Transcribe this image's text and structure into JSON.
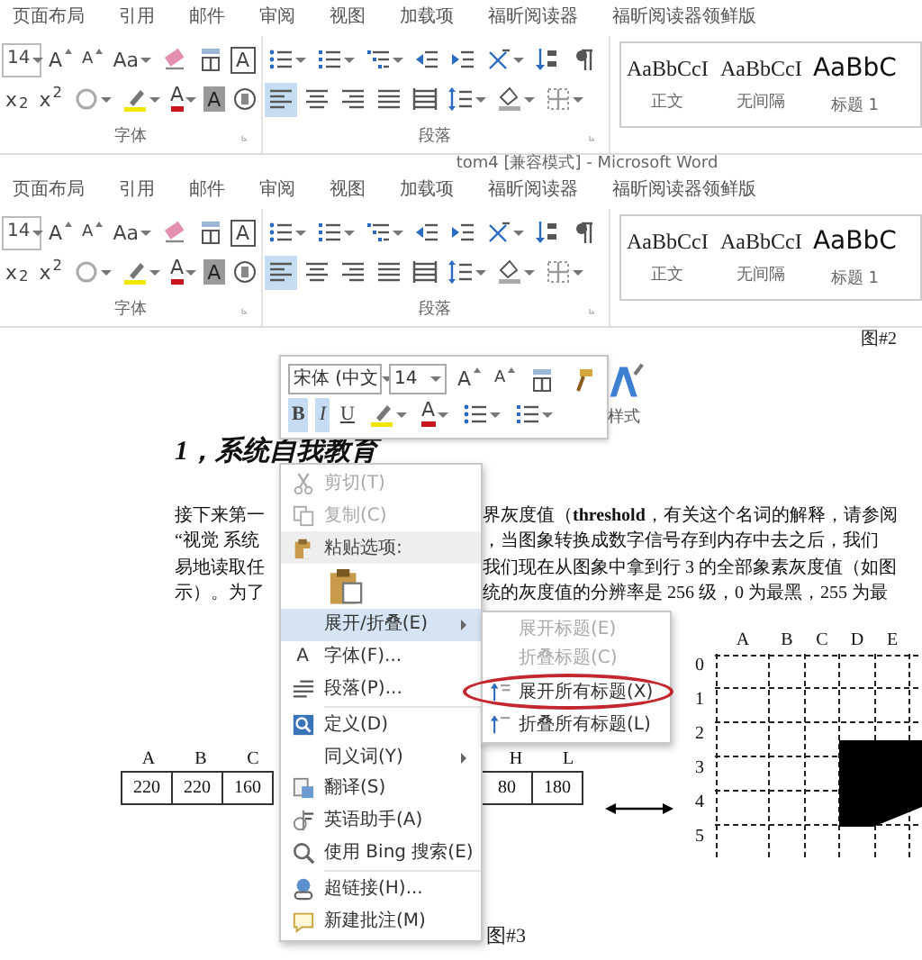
{
  "ribbons": [
    {
      "tabs": [
        "页面布局",
        "引用",
        "邮件",
        "审阅",
        "视图",
        "加载项",
        "福昕阅读器",
        "福昕阅读器领鲜版"
      ],
      "font_group": {
        "label": "字体",
        "rows": [
          [
            {
              "kind": "dropdown",
              "label": "14"
            },
            {
              "kind": "grow",
              "label": "A"
            },
            {
              "kind": "shrink",
              "label": "A"
            },
            {
              "kind": "case",
              "label": "Aa"
            },
            {
              "kind": "icon"
            },
            {
              "kind": "icon"
            },
            {
              "kind": "boxed",
              "label": "A"
            }
          ],
          [
            {
              "kind": "sub",
              "label": "x$_{2}$"
            },
            {
              "kind": "sup",
              "label": "x$^{2}$"
            },
            {
              "kind": "icon",
              "caret": true
            },
            {
              "kind": "icon",
              "caret": true
            },
            {
              "kind": "font-color",
              "label": "A",
              "caret": true
            },
            {
              "kind": "shaded",
              "label": "A"
            },
            {
              "kind": "icon"
            }
          ]
        ]
      },
      "paragraph_group": {
        "label": "段落",
        "rows": [
          [
            {
              "kind": "icon",
              "caret": true,
              "selected": false
            },
            {
              "kind": "icon",
              "caret": true,
              "selected": false
            },
            {
              "kind": "icon",
              "caret": true,
              "selected": false
            },
            {
              "kind": "icon",
              "selected": false
            },
            {
              "kind": "icon",
              "selected": false
            },
            {
              "kind": "icon",
              "caret": true,
              "selected": false
            },
            {
              "kind": "icon",
              "selected": false
            },
            {
              "kind": "icon",
              "selected": false
            }
          ],
          [
            {
              "kind": "icon",
              "selected": true
            },
            {
              "kind": "icon",
              "selected": false
            },
            {
              "kind": "icon",
              "selected": false
            },
            {
              "kind": "icon",
              "selected": false
            },
            {
              "kind": "icon",
              "selected": false
            },
            {
              "kind": "icon",
              "caret": true,
              "selected": false
            },
            {
              "kind": "icon",
              "caret": true,
              "selected": false
            },
            {
              "kind": "icon",
              "caret": true,
              "selected": false
            }
          ]
        ]
      },
      "styles": [
        {
          "sample": "AaBbCcI",
          "name": "正文",
          "kind": "body"
        },
        {
          "sample": "AaBbCcI",
          "name": "无间隔",
          "kind": "body"
        },
        {
          "sample": "AaBbC",
          "name": "标题 1",
          "kind": "heading"
        }
      ]
    },
    {
      "tabs": [
        "页面布局",
        "引用",
        "邮件",
        "审阅",
        "视图",
        "加载项",
        "福昕阅读器",
        "福昕阅读器领鲜版"
      ],
      "font_group": {
        "label": "字体",
        "rows": [
          [
            {
              "kind": "dropdown",
              "label": "14"
            },
            {
              "kind": "grow",
              "label": "A"
            },
            {
              "kind": "shrink",
              "label": "A"
            },
            {
              "kind": "case",
              "label": "Aa"
            },
            {
              "kind": "icon"
            },
            {
              "kind": "icon"
            },
            {
              "kind": "boxed",
              "label": "A"
            }
          ],
          [
            {
              "kind": "sub",
              "label": "x$_{2}$"
            },
            {
              "kind": "sup",
              "label": "x$^{2}$"
            },
            {
              "kind": "icon",
              "caret": true
            },
            {
              "kind": "icon",
              "caret": true
            },
            {
              "kind": "font-color",
              "label": "A",
              "caret": true
            },
            {
              "kind": "shaded",
              "label": "A"
            },
            {
              "kind": "icon"
            }
          ]
        ]
      },
      "paragraph_group": {
        "label": "段落",
        "rows": [
          [
            {
              "kind": "icon",
              "caret": true,
              "selected": false
            },
            {
              "kind": "icon",
              "caret": true,
              "selected": false
            },
            {
              "kind": "icon",
              "caret": true,
              "selected": false
            },
            {
              "kind": "icon",
              "selected": false
            },
            {
              "kind": "icon",
              "selected": false
            },
            {
              "kind": "icon",
              "caret": true,
              "selected": false
            },
            {
              "kind": "icon",
              "selected": false
            },
            {
              "kind": "icon",
              "selected": false
            }
          ],
          [
            {
              "kind": "icon",
              "selected": true
            },
            {
              "kind": "icon",
              "selected": false
            },
            {
              "kind": "icon",
              "selected": false
            },
            {
              "kind": "icon",
              "selected": false
            },
            {
              "kind": "icon",
              "selected": false
            },
            {
              "kind": "icon",
              "caret": true,
              "selected": false
            },
            {
              "kind": "icon",
              "caret": true,
              "selected": false
            },
            {
              "kind": "icon",
              "caret": true,
              "selected": false
            }
          ]
        ]
      },
      "styles": [
        {
          "sample": "AaBbCcI",
          "name": "正文",
          "kind": "body"
        },
        {
          "sample": "AaBbCcI",
          "name": "无间隔",
          "kind": "body"
        },
        {
          "sample": "AaBbC",
          "name": "标题 1",
          "kind": "heading"
        }
      ]
    }
  ],
  "window": {
    "title": "tom4 [兼容模式] - Microsoft Word"
  },
  "document": {
    "top_caption": "图#2",
    "heading": "1，系统自我教育",
    "lines": [
      {
        "left": "接下来第一",
        "right": "界灰度值（**threshold**，有关这个名词的解释，请参阅"
      },
      {
        "left": "“视觉 系统",
        "right": "，当图象转换成数字信号存到内存中去之后，我们"
      },
      {
        "left": "易地读取任",
        "right": "我们现在从图象中拿到行 3 的全部象素灰度值（如图"
      },
      {
        "left": "示）。为了",
        "right": "统的灰度值的分辨率是 256 级，0 为最黑，255 为最"
      }
    ],
    "table": {
      "left": [
        {
          "letter": "A",
          "value": "220"
        },
        {
          "letter": "B",
          "value": "220"
        },
        {
          "letter": "C",
          "value": "160"
        }
      ],
      "right": [
        {
          "letter": "H",
          "value": "80"
        },
        {
          "letter": "L",
          "value": "180"
        }
      ]
    },
    "grid": {
      "columns": [
        "A",
        "B",
        "C",
        "D",
        "E"
      ],
      "rows": [
        "0",
        "1",
        "2",
        "3",
        "4",
        "5"
      ]
    },
    "bottom_caption": "图#3"
  },
  "mini_toolbar": {
    "font_name": "宋体 (中文",
    "font_size": "14",
    "buttons": [
      {
        "kind": "grow",
        "label": "A"
      },
      {
        "kind": "shrink",
        "label": "A"
      },
      {
        "kind": "icon"
      },
      {
        "kind": "icon"
      }
    ],
    "styles_label": "样式",
    "toggles": [
      {
        "kind": "bold",
        "label": "B",
        "selected": true
      },
      {
        "kind": "italic",
        "label": "I",
        "selected": true
      },
      {
        "kind": "underline",
        "label": "U",
        "selected": false
      }
    ],
    "format_buttons": [
      {
        "kind": "icon",
        "caret": true
      },
      {
        "kind": "font-color",
        "label": "A",
        "caret": true
      },
      {
        "kind": "icon",
        "caret": true
      },
      {
        "kind": "icon",
        "caret": true
      }
    ]
  },
  "context_menu": [
    {
      "kind": "item",
      "label": "剪切(T)",
      "disabled": true,
      "selected": false
    },
    {
      "kind": "item",
      "label": "复制(C)",
      "disabled": true,
      "selected": false
    },
    {
      "kind": "header",
      "label": "粘贴选项:"
    },
    {
      "kind": "paste-option"
    },
    {
      "kind": "item",
      "label": "展开/折叠(E)",
      "submenu": true,
      "disabled": false,
      "selected": true
    },
    {
      "kind": "item",
      "glyph": "A",
      "label": "字体(F)...",
      "disabled": false,
      "selected": false
    },
    {
      "kind": "item",
      "label": "段落(P)...",
      "disabled": false,
      "selected": false
    },
    {
      "kind": "separator"
    },
    {
      "kind": "item",
      "label": "定义(D)",
      "disabled": false,
      "selected": false
    },
    {
      "kind": "item",
      "label": "同义词(Y)",
      "submenu": true,
      "disabled": false,
      "selected": false
    },
    {
      "kind": "item",
      "label": "翻译(S)",
      "disabled": false,
      "selected": false
    },
    {
      "kind": "item",
      "label": "英语助手(A)",
      "disabled": false,
      "selected": false
    },
    {
      "kind": "item",
      "label": "使用 Bing 搜索(E)",
      "disabled": false,
      "selected": false
    },
    {
      "kind": "separator"
    },
    {
      "kind": "item",
      "label": "超链接(H)...",
      "disabled": false,
      "selected": false
    },
    {
      "kind": "item",
      "label": "新建批注(M)",
      "disabled": false,
      "selected": false
    }
  ],
  "submenu": [
    {
      "label": "展开标题(E)",
      "disabled": true,
      "circled": false
    },
    {
      "label": "折叠标题(C)",
      "disabled": true,
      "circled": false
    },
    {
      "label": "展开所有标题(X)",
      "disabled": false,
      "circled": true
    },
    {
      "label": "折叠所有标题(L)",
      "disabled": false,
      "circled": false
    }
  ]
}
